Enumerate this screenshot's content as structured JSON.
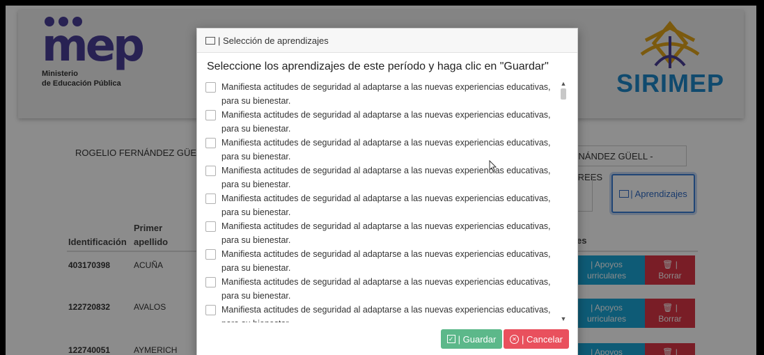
{
  "header": {
    "mep_logo_text": "mep",
    "mep_subtitle_1": "Ministerio",
    "mep_subtitle_2": "de Educación Pública",
    "sirimep_logo_text": "SIRIMEP"
  },
  "student": {
    "name_left": "ROGELIO FERNÁNDEZ GÜELL",
    "name_right": "RNÁNDEZ GÜELL - PREES",
    "aprendizajes_button": "| Aprendizajes"
  },
  "table": {
    "headers": {
      "identificacion": "Identificación",
      "primer": "Primer",
      "apellido": "apellido",
      "acciones_partial": "es"
    },
    "rows": [
      {
        "id": "403170398",
        "apellido": "ACUÑA",
        "apoyo_1": "| Apoyos",
        "apoyo_2": "urriculares",
        "borrar": "Borrar"
      },
      {
        "id": "122720832",
        "apellido": "AVALOS",
        "apoyo_1": "| Apoyos",
        "apoyo_2": "urriculares",
        "borrar": "Borrar"
      },
      {
        "id": "122740051",
        "apellido": "AYMERICH",
        "apoyo_1": "| Apoyos",
        "apoyo_2": "",
        "borrar": ""
      }
    ]
  },
  "modal": {
    "title": "| Selección de aprendizajes",
    "prompt": "Seleccione los aprendizajes de este período y haga clic en \"Guardar\"",
    "items": [
      "Manifiesta actitudes de seguridad al adaptarse a las nuevas experiencias educativas, para su bienestar.",
      "Manifiesta actitudes de seguridad al adaptarse a las nuevas experiencias educativas, para su bienestar.",
      "Manifiesta actitudes de seguridad al adaptarse a las nuevas experiencias educativas, para su bienestar.",
      "Manifiesta actitudes de seguridad al adaptarse a las nuevas experiencias educativas, para su bienestar.",
      "Manifiesta actitudes de seguridad al adaptarse a las nuevas experiencias educativas, para su bienestar.",
      "Manifiesta actitudes de seguridad al adaptarse a las nuevas experiencias educativas, para su bienestar.",
      "Manifiesta actitudes de seguridad al adaptarse a las nuevas experiencias educativas, para su bienestar.",
      "Manifiesta actitudes de seguridad al adaptarse a las nuevas experiencias educativas, para su bienestar.",
      "Manifiesta actitudes de seguridad al adaptarse a las nuevas experiencias educativas, para su bienestar."
    ],
    "save_button": "| Guardar",
    "cancel_button": "| Cancelar"
  },
  "colors": {
    "mep_purple": "#4a3f97",
    "sirimep_blue": "#1e88c9",
    "sirimep_gold": "#e0a41b",
    "save_green": "#5cb88a",
    "cancel_red": "#e9505d",
    "apoyo_blue": "#1aa7d8",
    "borrar_red": "#dc3545"
  },
  "icons": [
    "list-icon",
    "check-square-icon",
    "x-circle-icon",
    "trash-icon",
    "mouse-cursor-icon"
  ]
}
